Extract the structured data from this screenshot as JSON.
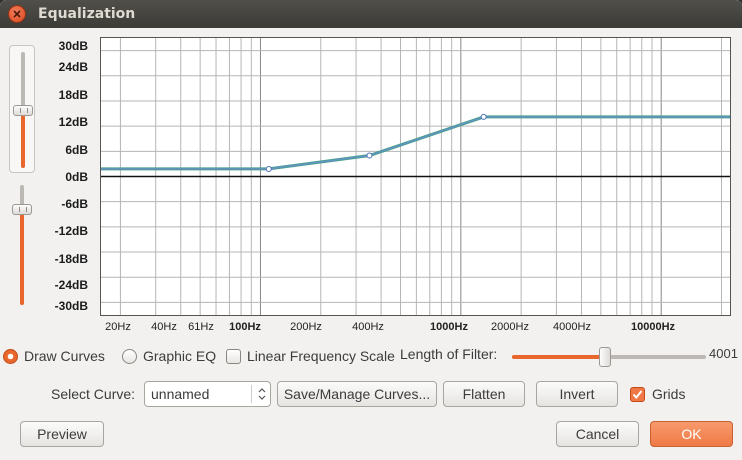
{
  "window": {
    "title": "Equalization"
  },
  "db_labels": [
    "30dB",
    "24dB",
    "18dB",
    "12dB",
    "6dB",
    "0dB",
    "-6dB",
    "-12dB",
    "-18dB",
    "-24dB",
    "-30dB"
  ],
  "freq_labels": [
    "20Hz",
    "40Hz",
    "61Hz",
    "100Hz",
    "200Hz",
    "400Hz",
    "1000Hz",
    "2000Hz",
    "4000Hz",
    "10000Hz"
  ],
  "options": {
    "draw_curves": "Draw Curves",
    "graphic_eq": "Graphic EQ",
    "linear_freq": "Linear Frequency Scale",
    "mode_selected": "draw_curves",
    "linear_freq_checked": false
  },
  "filter": {
    "label": "Length of Filter:",
    "value": "4001",
    "level_fraction": 0.48
  },
  "curve": {
    "label": "Select Curve:",
    "selected": "unnamed"
  },
  "buttons": {
    "save_manage": "Save/Manage Curves...",
    "flatten": "Flatten",
    "invert": "Invert",
    "preview": "Preview",
    "cancel": "Cancel",
    "ok": "OK"
  },
  "grids": {
    "label": "Grids",
    "checked": true
  },
  "vertical_sliders": {
    "gain_range": "30dB",
    "scale": "0dB"
  },
  "colors": {
    "accent": "#e9662c",
    "curve": "#4a9e8e",
    "curve_inner": "#6a8fd8"
  },
  "chart_data": {
    "type": "line",
    "x_scale": "log",
    "xlim": [
      16,
      22050
    ],
    "ylim": [
      -33,
      33
    ],
    "x": [
      16,
      110,
      350,
      1300,
      22050
    ],
    "y": [
      1.8,
      1.8,
      5.0,
      14.2,
      14.2
    ],
    "control_points": [
      [
        110,
        1.8
      ],
      [
        350,
        5.0
      ],
      [
        1300,
        14.2
      ]
    ],
    "grid": true
  }
}
